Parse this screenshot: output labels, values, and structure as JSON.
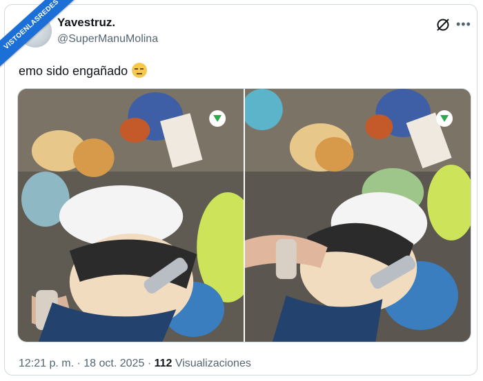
{
  "watermark": "VISTOENLASREDES",
  "author": {
    "display_name": "Yavestruz.",
    "handle": "@SuperManuMolina"
  },
  "tweet": {
    "text": "emo sido engañado"
  },
  "icons": {
    "grok": "grok-slash-icon",
    "more": "more-dots-icon",
    "emoji": "relieved-face-emoji",
    "download_arrow": "green-down-arrow-icon"
  },
  "footer": {
    "time": "12:21 p. m.",
    "separator": "·",
    "date": "18 oct. 2025",
    "views_count": "112",
    "views_label": "Visualizaciones"
  },
  "colors": {
    "accent_ribbon": "#1d6fd8",
    "secondary_text": "#536471",
    "border": "#cfd9de"
  }
}
